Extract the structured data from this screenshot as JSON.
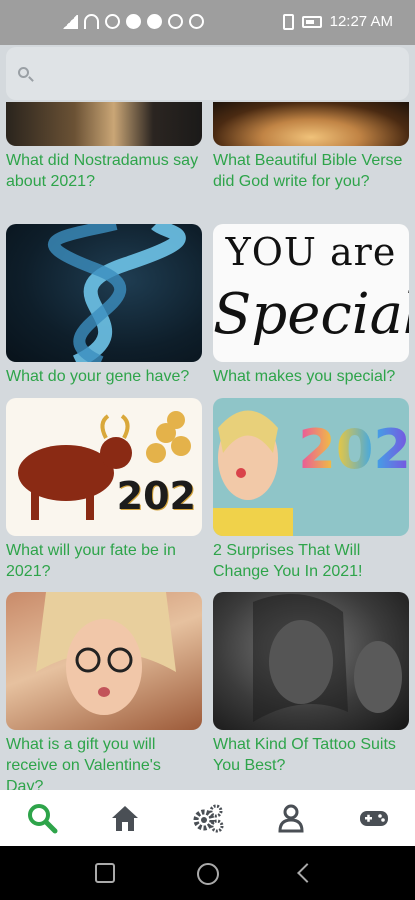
{
  "status_bar": {
    "time": "12:27 AM"
  },
  "search": {
    "placeholder": "",
    "value": ""
  },
  "cards": [
    {
      "caption": "What did Nostradamus say about 2021?"
    },
    {
      "caption": "What Beautiful Bible Verse did God write for you?"
    },
    {
      "caption": "What do your gene have?"
    },
    {
      "caption": "What makes you special?"
    },
    {
      "caption": "What will your fate be in 2021?"
    },
    {
      "caption": "2 Surprises That Will Change You In 2021!"
    },
    {
      "caption": "What is a gift you will receive on Valentine's Day?"
    },
    {
      "caption": "What Kind Of Tattoo Suits You Best?"
    }
  ],
  "images": {
    "special_line1": "YOU are",
    "special_line2": "Special",
    "year_a": "202",
    "year_b": "202"
  },
  "bottom_nav": [
    {
      "icon": "search-icon",
      "active": true
    },
    {
      "icon": "home-icon"
    },
    {
      "icon": "settings-gears-icon"
    },
    {
      "icon": "profile-icon"
    },
    {
      "icon": "gamepad-icon"
    }
  ],
  "colors": {
    "accent": "#2ea44a",
    "background": "#d4d9dd",
    "icon_inactive": "#4a4f55"
  }
}
